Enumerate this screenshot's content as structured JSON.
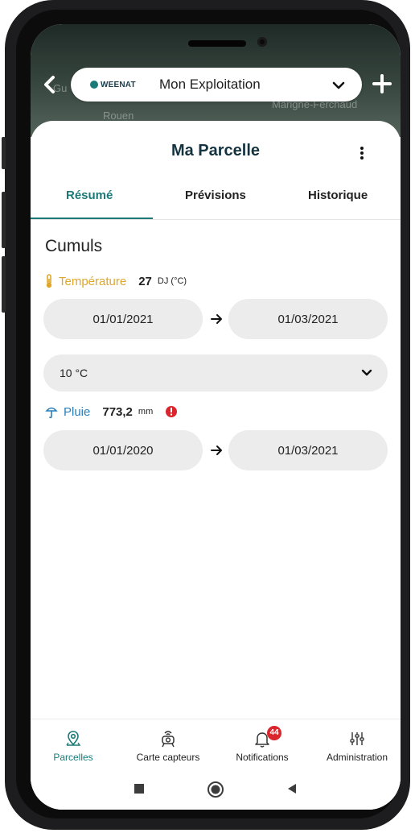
{
  "header": {
    "brand_logo": "WEENAT",
    "farm_name": "Mon Exploitation"
  },
  "page": {
    "title": "Ma Parcelle"
  },
  "tabs": [
    {
      "label": "Résumé",
      "active": true
    },
    {
      "label": "Prévisions",
      "active": false
    },
    {
      "label": "Historique",
      "active": false
    }
  ],
  "cumuls": {
    "section_title": "Cumuls",
    "temperature": {
      "label": "Température",
      "value": "27",
      "unit": "DJ (°C)",
      "start_date": "01/01/2021",
      "end_date": "01/03/2021",
      "threshold": "10 °C"
    },
    "rain": {
      "label": "Pluie",
      "value": "773,2",
      "unit": "mm",
      "start_date": "01/01/2020",
      "end_date": "01/03/2021"
    }
  },
  "bottom_nav": [
    {
      "label": "Parcelles",
      "icon": "map-pin-icon",
      "active": true
    },
    {
      "label": "Carte capteurs",
      "icon": "sensor-icon",
      "active": false
    },
    {
      "label": "Notifications",
      "icon": "bell-icon",
      "active": false,
      "badge": "44"
    },
    {
      "label": "Administration",
      "icon": "sliders-icon",
      "active": false
    }
  ],
  "colors": {
    "accent": "#1b7a78",
    "title": "#14333f",
    "temperature": "#e0a62a",
    "rain": "#2a7fb8",
    "badge": "#d9252b",
    "chip_bg": "#ececec"
  }
}
